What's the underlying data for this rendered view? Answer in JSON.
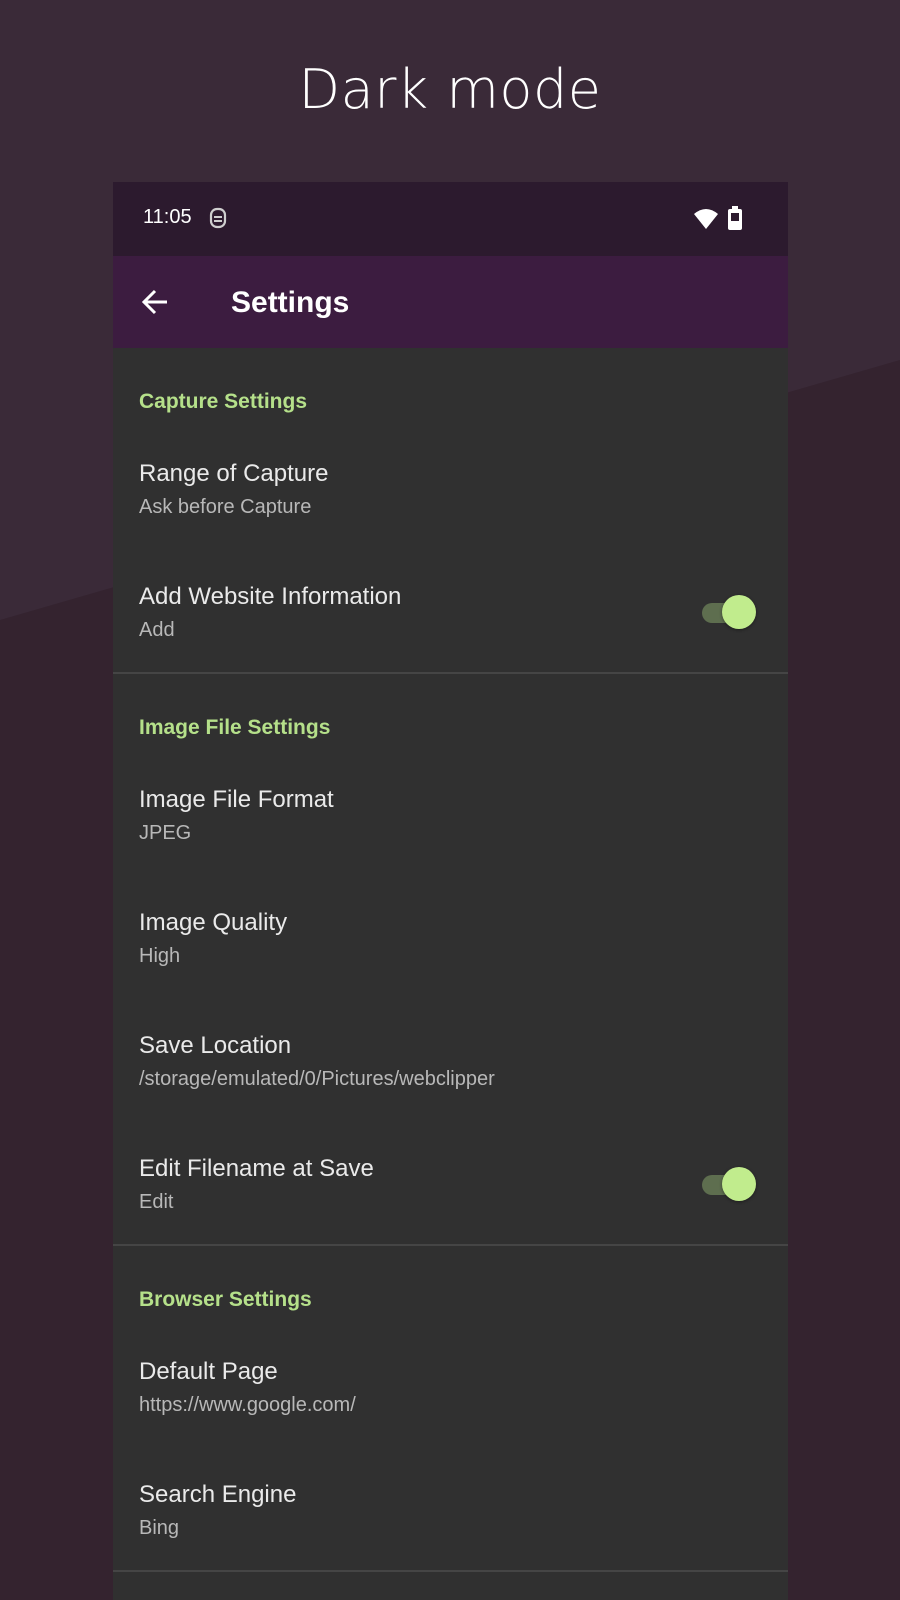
{
  "headline": "Dark mode",
  "status_bar": {
    "time": "11:05",
    "notification_icon": "app-notification-icon",
    "wifi_icon": "wifi-icon",
    "battery_icon": "battery-icon"
  },
  "app_bar": {
    "back_icon": "arrow-left-icon",
    "title": "Settings"
  },
  "colors": {
    "accent": "#b5e08a",
    "toggle_thumb": "#c1ec8d",
    "app_bar": "#3c1c40",
    "status_bar": "#2c1a2e",
    "content_bg": "#303030",
    "page_bg": "#3a2a38"
  },
  "sections": [
    {
      "header": "Capture Settings",
      "items": [
        {
          "title": "Range of Capture",
          "summary": "Ask before Capture"
        },
        {
          "title": "Add Website Information",
          "summary": "Add",
          "toggle": true
        }
      ]
    },
    {
      "header": "Image File Settings",
      "items": [
        {
          "title": "Image File Format",
          "summary": "JPEG"
        },
        {
          "title": "Image Quality",
          "summary": "High"
        },
        {
          "title": "Save Location",
          "summary": "/storage/emulated/0/Pictures/webclipper"
        },
        {
          "title": "Edit Filename at Save",
          "summary": "Edit",
          "toggle": true
        }
      ]
    },
    {
      "header": "Browser Settings",
      "items": [
        {
          "title": "Default Page",
          "summary": "https://www.google.com/"
        },
        {
          "title": "Search Engine",
          "summary": "Bing"
        }
      ]
    }
  ]
}
